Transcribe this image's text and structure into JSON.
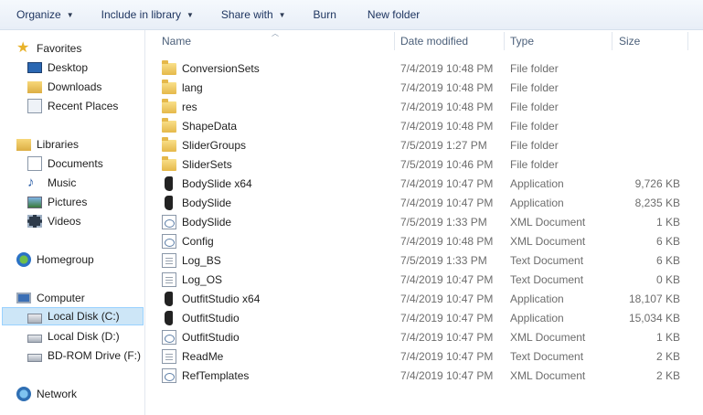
{
  "toolbar": {
    "organize": "Organize",
    "include_in_library": "Include in library",
    "share_with": "Share with",
    "burn": "Burn",
    "new_folder": "New folder"
  },
  "nav": {
    "favorites": "Favorites",
    "desktop": "Desktop",
    "downloads": "Downloads",
    "recent_places": "Recent Places",
    "libraries": "Libraries",
    "documents": "Documents",
    "music": "Music",
    "pictures": "Pictures",
    "videos": "Videos",
    "homegroup": "Homegroup",
    "computer": "Computer",
    "local_disk_c": "Local Disk (C:)",
    "local_disk_d": "Local Disk (D:)",
    "bd_rom": "BD-ROM Drive (F:) C",
    "network": "Network"
  },
  "columns": {
    "name": "Name",
    "date_modified": "Date modified",
    "type": "Type",
    "size": "Size"
  },
  "files": [
    {
      "name": "ConversionSets",
      "date": "7/4/2019 10:48 PM",
      "type": "File folder",
      "size": "",
      "icon": "folder-icon"
    },
    {
      "name": "lang",
      "date": "7/4/2019 10:48 PM",
      "type": "File folder",
      "size": "",
      "icon": "folder-icon"
    },
    {
      "name": "res",
      "date": "7/4/2019 10:48 PM",
      "type": "File folder",
      "size": "",
      "icon": "folder-icon"
    },
    {
      "name": "ShapeData",
      "date": "7/4/2019 10:48 PM",
      "type": "File folder",
      "size": "",
      "icon": "folder-icon"
    },
    {
      "name": "SliderGroups",
      "date": "7/5/2019 1:27 PM",
      "type": "File folder",
      "size": "",
      "icon": "folder-icon"
    },
    {
      "name": "SliderSets",
      "date": "7/5/2019 10:46 PM",
      "type": "File folder",
      "size": "",
      "icon": "folder-icon"
    },
    {
      "name": "BodySlide x64",
      "date": "7/4/2019 10:47 PM",
      "type": "Application",
      "size": "9,726 KB",
      "icon": "app-icon"
    },
    {
      "name": "BodySlide",
      "date": "7/4/2019 10:47 PM",
      "type": "Application",
      "size": "8,235 KB",
      "icon": "app-icon"
    },
    {
      "name": "BodySlide",
      "date": "7/5/2019 1:33 PM",
      "type": "XML Document",
      "size": "1 KB",
      "icon": "xml-icon"
    },
    {
      "name": "Config",
      "date": "7/4/2019 10:48 PM",
      "type": "XML Document",
      "size": "6 KB",
      "icon": "xml-icon"
    },
    {
      "name": "Log_BS",
      "date": "7/5/2019 1:33 PM",
      "type": "Text Document",
      "size": "6 KB",
      "icon": "txt-icon"
    },
    {
      "name": "Log_OS",
      "date": "7/4/2019 10:47 PM",
      "type": "Text Document",
      "size": "0 KB",
      "icon": "txt-icon"
    },
    {
      "name": "OutfitStudio x64",
      "date": "7/4/2019 10:47 PM",
      "type": "Application",
      "size": "18,107 KB",
      "icon": "app-icon"
    },
    {
      "name": "OutfitStudio",
      "date": "7/4/2019 10:47 PM",
      "type": "Application",
      "size": "15,034 KB",
      "icon": "app-icon"
    },
    {
      "name": "OutfitStudio",
      "date": "7/4/2019 10:47 PM",
      "type": "XML Document",
      "size": "1 KB",
      "icon": "xml-icon"
    },
    {
      "name": "ReadMe",
      "date": "7/4/2019 10:47 PM",
      "type": "Text Document",
      "size": "2 KB",
      "icon": "txt-icon"
    },
    {
      "name": "RefTemplates",
      "date": "7/4/2019 10:47 PM",
      "type": "XML Document",
      "size": "2 KB",
      "icon": "xml-icon"
    }
  ]
}
